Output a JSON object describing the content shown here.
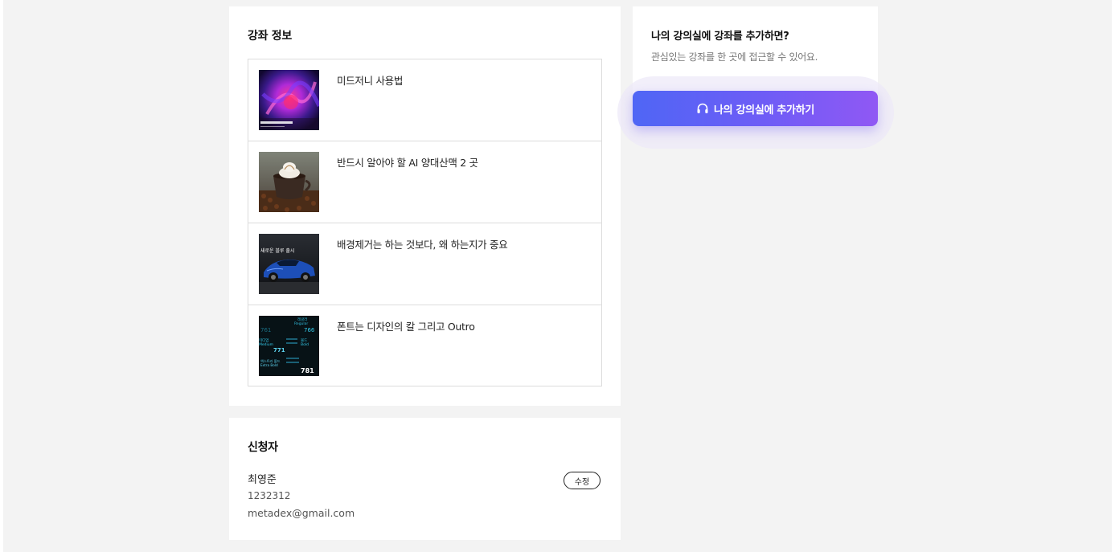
{
  "course_section": {
    "title": "강좌 정보",
    "courses": [
      {
        "title": "미드저니 사용법",
        "thumb_icon": "abstract-art-thumbnail"
      },
      {
        "title": "반드시 알아야 할 AI 양대산맥 2 곳",
        "thumb_icon": "coffee-cup-thumbnail"
      },
      {
        "title": "배경제거는 하는 것보다, 왜 하는지가 중요",
        "thumb_icon": "blue-car-thumbnail",
        "thumb_text": "새로운 블루 출시"
      },
      {
        "title": "폰트는 디자인의 칼 그리고 Outro",
        "thumb_icon": "font-weights-thumbnail",
        "thumb_text": [
          "레귤러",
          "Regular",
          "761",
          "766",
          "미디엄",
          "Medium",
          "볼드",
          "Bold",
          "771",
          "엑스트라 볼드",
          "Extra Bold",
          "781"
        ]
      }
    ]
  },
  "applicant": {
    "title": "신청자",
    "name": "최영준",
    "phone": "1232312",
    "email": "metadex@gmail.com",
    "edit_label": "수정"
  },
  "promo": {
    "title": "나의 강의실에 강좌를 추가하면?",
    "subtitle": "관심있는 강좌를 한 곳에 접근할 수 있어요.",
    "button_label": "나의 강의실에 추가하기",
    "button_icon": "headphones-icon"
  },
  "colors": {
    "page_bg": "#f3f3f3",
    "button_gradient_start": "#4f66f5",
    "button_gradient_end": "#9058f4"
  }
}
